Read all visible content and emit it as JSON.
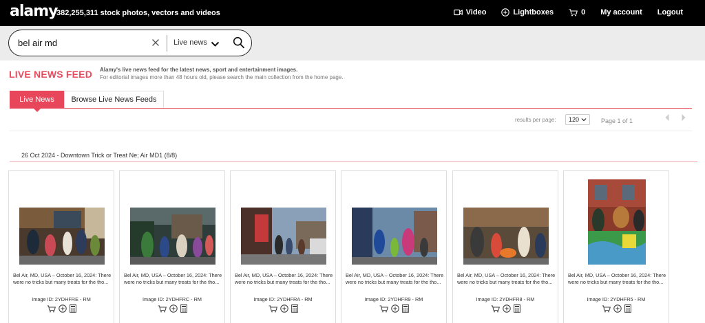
{
  "header": {
    "logo": "alamy",
    "stock_count": "382,255,311  stock photos, vectors and videos",
    "nav": {
      "video": "Video",
      "lightboxes": "Lightboxes",
      "cart_count": "0",
      "my_account": "My account",
      "logout": "Logout"
    }
  },
  "search": {
    "query": "bel air md",
    "scope": "Live news"
  },
  "section": {
    "title": "LIVE NEWS FEED",
    "desc_line1": "Alamy's live news feed for the latest news, sport and entertainment images.",
    "desc_line2": "For editorial images more than 48 hours old, please search the main collection from the home page."
  },
  "tabs": [
    {
      "label": "Live News",
      "active": true
    },
    {
      "label": "Browse Live News Feeds",
      "active": false
    }
  ],
  "pagination": {
    "results_per_page_label": "results per page:",
    "results_per_page_value": "120",
    "page_info": "Page 1 of 1"
  },
  "group": {
    "title": "26 Oct 2024 - Downtown Trick or Treat Ne; Air MD1 (8/8)"
  },
  "results": [
    {
      "caption": "Bel Air, MD, USA – October 16, 2024: There were no tricks but many treats for the tho...",
      "image_id": "Image ID: 2YDHFRE - RM"
    },
    {
      "caption": "Bel Air, MD, USA – October 16, 2024: There were no tricks but many treats for the tho...",
      "image_id": "Image ID: 2YDHFRC - RM"
    },
    {
      "caption": "Bel Air, MD, USA – October 16, 2024: There were no tricks but many treats for the tho...",
      "image_id": "Image ID: 2YDHFRA - RM"
    },
    {
      "caption": "Bel Air, MD, USA – October 16, 2024: There were no tricks but many treats for the tho...",
      "image_id": "Image ID: 2YDHFR9 - RM"
    },
    {
      "caption": "Bel Air, MD, USA – October 16, 2024: There were no tricks but many treats for the tho...",
      "image_id": "Image ID: 2YDHFR8 - RM"
    },
    {
      "caption": "Bel Air, MD, USA – October 16, 2024: There were no tricks but many treats for the tho...",
      "image_id": "Image ID: 2YDHFR5 - RM"
    }
  ],
  "colors": {
    "accent": "#e8465b",
    "topbar": "#000000",
    "search_band": "#ececec"
  }
}
